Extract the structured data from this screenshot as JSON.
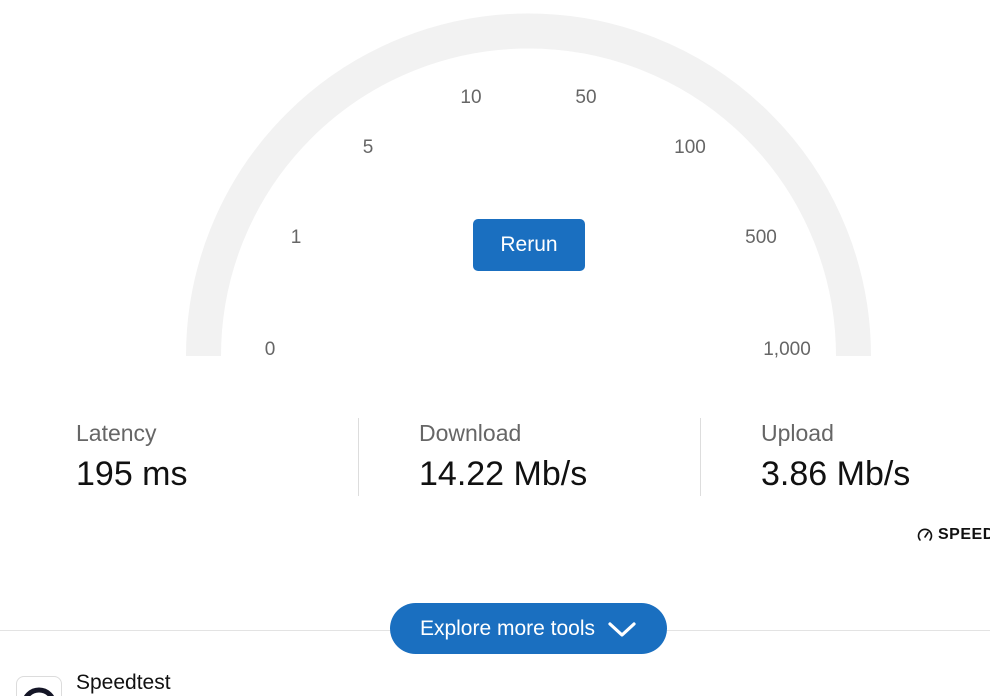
{
  "gauge": {
    "ticks": [
      "0",
      "1",
      "5",
      "10",
      "50",
      "100",
      "500",
      "1,000"
    ],
    "rerun_label": "Rerun",
    "track_color": "#f2f2f2"
  },
  "metrics": {
    "latency": {
      "label": "Latency",
      "value": "195 ms"
    },
    "download": {
      "label": "Download",
      "value": "14.22 Mb/s"
    },
    "upload": {
      "label": "Upload",
      "value": "3.86 Mb/s"
    }
  },
  "brand": {
    "text": "SPEED",
    "icon": "speedometer-icon"
  },
  "explore": {
    "label": "Explore more tools",
    "icon": "chevron-down-icon"
  },
  "result_item": {
    "title": "Speedtest",
    "icon": "speedtest-app-icon"
  },
  "colors": {
    "accent": "#1a6fc0",
    "text": "#111111",
    "muted": "#666666"
  }
}
